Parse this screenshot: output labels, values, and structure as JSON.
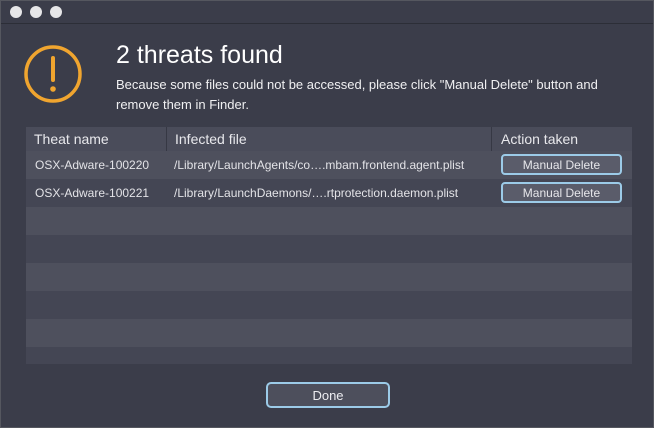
{
  "dialog": {
    "headline": "2 threats found",
    "message": "Because some files could not be accessed, please click \"Manual Delete\" button and remove them in Finder."
  },
  "table": {
    "columns": [
      "Theat name",
      "Infected file",
      "Action taken"
    ],
    "rows": [
      {
        "name": "OSX-Adware-100220",
        "file": "/Library/LaunchAgents/co….mbam.frontend.agent.plist",
        "action": "Manual Delete"
      },
      {
        "name": "OSX-Adware-100221",
        "file": "/Library/LaunchDaemons/….rtprotection.daemon.plist",
        "action": "Manual Delete"
      }
    ]
  },
  "footer": {
    "done_label": "Done"
  },
  "colors": {
    "warning": "#f0a52f",
    "button_border": "#9ccbe8"
  },
  "icons": {
    "warning": "warning-icon"
  }
}
